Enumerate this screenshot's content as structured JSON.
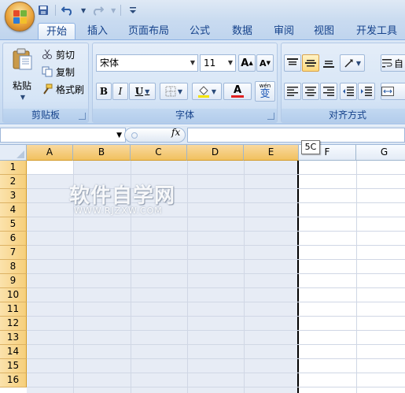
{
  "quick_access": {
    "items": [
      "save-icon",
      "undo-icon",
      "redo-icon",
      "customize-icon"
    ]
  },
  "tabs": [
    {
      "label": "开始",
      "active": true
    },
    {
      "label": "插入"
    },
    {
      "label": "页面布局"
    },
    {
      "label": "公式"
    },
    {
      "label": "数据"
    },
    {
      "label": "审阅"
    },
    {
      "label": "视图"
    },
    {
      "label": "开发工具"
    }
  ],
  "ribbon": {
    "clipboard": {
      "label": "剪贴板",
      "paste_label": "粘贴",
      "cut_label": "剪切",
      "copy_label": "复制",
      "format_painter_label": "格式刷"
    },
    "font": {
      "label": "字体",
      "font_name": "宋体",
      "font_size": "11",
      "grow_label": "A",
      "shrink_label": "A",
      "bold_label": "B",
      "italic_label": "I",
      "underline_label": "U",
      "font_color_label": "A",
      "phonetic_label": "变",
      "phonetic_small": "wén"
    },
    "alignment": {
      "label": "对齐方式",
      "wrap_label": "自"
    }
  },
  "formula_bar": {
    "name_box": "",
    "fx_label": "fx",
    "formula": ""
  },
  "grid": {
    "columns": [
      "A",
      "B",
      "C",
      "D",
      "E",
      "F",
      "G"
    ],
    "rows": [
      "1",
      "2",
      "3",
      "4",
      "5",
      "6",
      "7",
      "8",
      "9",
      "10",
      "11",
      "12",
      "13",
      "14",
      "15",
      "16"
    ],
    "tooltip": "5C"
  },
  "watermark": {
    "big": "软件自学网",
    "small": "WWW.RJZXW.COM"
  },
  "colors": {
    "ribbon_text": "#15428b",
    "selected_header": "#f1c15f",
    "selection_fill": "#dbe3f1",
    "font_color_bar": "#e02020",
    "highlight_bar": "#f4e400"
  }
}
